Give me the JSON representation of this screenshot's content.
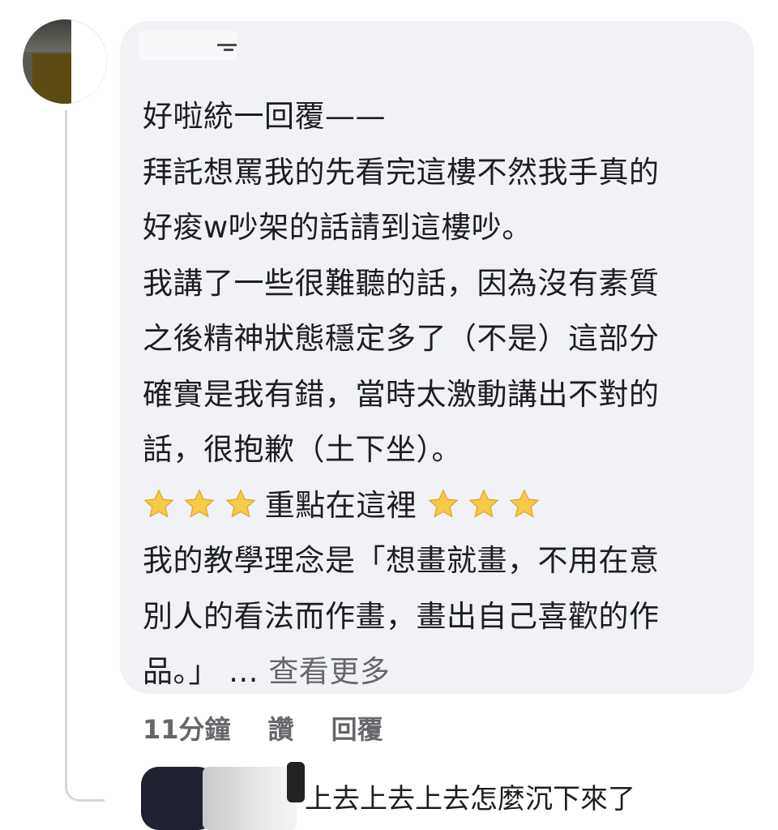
{
  "comment": {
    "lines": [
      "好啦統一回覆——",
      "拜託想罵我的先看完這樓不然我手真的",
      "好痠w吵架的話請到這樓吵。",
      "我講了一些很難聽的話，因為沒有素質",
      "之後精神狀態穩定多了（不是）這部分",
      "確實是我有錯，當時太激動講出不對的",
      "話，很抱歉（土下坐）。"
    ],
    "highlight_text": "重點在這裡",
    "lines_after": [
      "我的教學理念是「想畫就畫，不用在意",
      "別人的看法而作畫，畫出自己喜歡的作"
    ],
    "last_line": "品。」",
    "ellipsis": "...",
    "see_more_label": "查看更多"
  },
  "actions": {
    "timestamp": "11分鐘",
    "like_label": "讚",
    "reply_label": "回覆"
  },
  "reply": {
    "text": "上去上去上去怎麼沉下來了"
  },
  "colors": {
    "bubble_bg": "#f0f2f5",
    "text": "#1c1e21",
    "muted": "#65676b",
    "star": "#f7c948"
  },
  "icons": {
    "star": "star-emoji"
  }
}
